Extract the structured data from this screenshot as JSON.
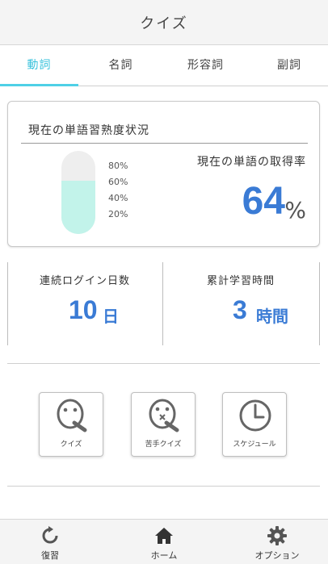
{
  "header": {
    "title": "クイズ"
  },
  "tabs": [
    {
      "label": "動詞",
      "active": true
    },
    {
      "label": "名詞",
      "active": false
    },
    {
      "label": "形容詞",
      "active": false
    },
    {
      "label": "副詞",
      "active": false
    }
  ],
  "proficiency": {
    "title": "現在の単語習熟度状況",
    "fill_fraction": 0.64,
    "ticks": [
      "80%",
      "60%",
      "40%",
      "20%"
    ],
    "rate_label": "現在の単語の取得率",
    "rate_value": "64",
    "rate_unit": "%"
  },
  "stats": {
    "login_label": "連続ログイン日数",
    "login_value": "10",
    "login_unit": "日",
    "study_label": "累計学習時間",
    "study_value": "3",
    "study_unit": "時間"
  },
  "actions": [
    {
      "label": "クイズ",
      "icon": "quiz-face-icon"
    },
    {
      "label": "苦手クイズ",
      "icon": "weak-quiz-face-icon"
    },
    {
      "label": "スケジュール",
      "icon": "clock-icon"
    }
  ],
  "bottom_nav": [
    {
      "label": "復習",
      "icon": "refresh-icon"
    },
    {
      "label": "ホーム",
      "icon": "home-icon"
    },
    {
      "label": "オプション",
      "icon": "gear-icon"
    }
  ],
  "colors": {
    "accent": "#3a7bd5",
    "tab_active": "#3cc3dd",
    "gauge_fill": "#c2f3ea"
  }
}
